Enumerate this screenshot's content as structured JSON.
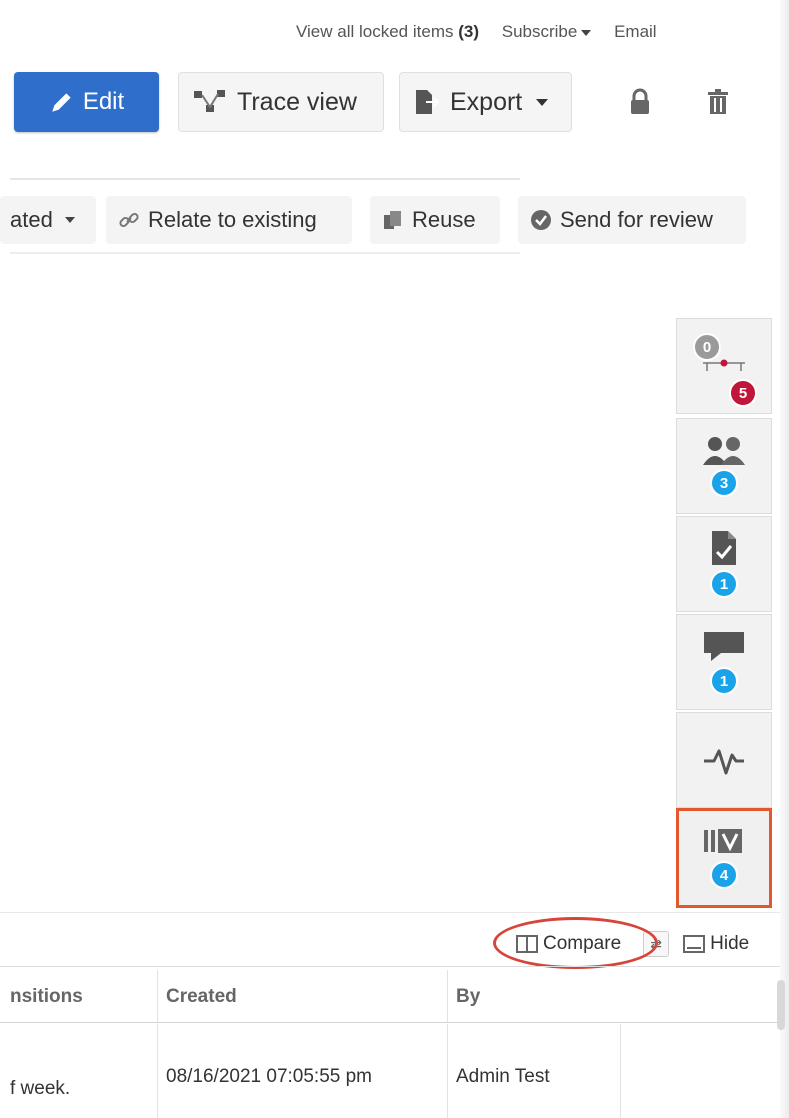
{
  "top_links": {
    "locked_prefix": "View all locked items",
    "locked_count": "(3)",
    "subscribe": "Subscribe",
    "email": "Email"
  },
  "toolbar": {
    "edit": "Edit",
    "trace_view": "Trace view",
    "export": "Export"
  },
  "secondary_toolbar": {
    "related": "ated",
    "relate_existing": "Relate to existing",
    "reuse": "Reuse",
    "send_review": "Send for review"
  },
  "side_panel": {
    "relationships": {
      "upstream": "0",
      "downstream": "5"
    },
    "collaborators": "3",
    "reviews": "1",
    "comments": "1",
    "versions": "4"
  },
  "compare_bar": {
    "compare": "Compare",
    "hide": "Hide"
  },
  "table": {
    "headers": [
      "nsitions",
      "Created",
      "By"
    ],
    "rows": [
      [
        "f week.",
        "08/16/2021 07:05:55 pm",
        "Admin Test"
      ]
    ]
  },
  "colors": {
    "primary": "#2f6fcb",
    "badge_blue": "#1aa3e8",
    "badge_red": "#c0163a",
    "highlight": "#e2572c"
  }
}
